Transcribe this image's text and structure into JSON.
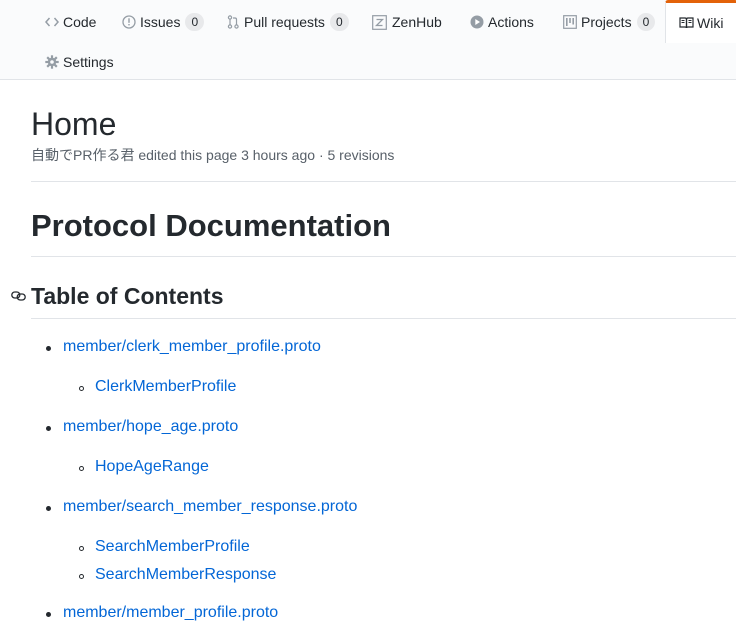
{
  "nav": {
    "tabs": [
      {
        "label": "Code",
        "icon": "code-icon"
      },
      {
        "label": "Issues",
        "icon": "issue-icon",
        "count": "0"
      },
      {
        "label": "Pull requests",
        "icon": "pull-request-icon",
        "count": "0"
      },
      {
        "label": "ZenHub",
        "icon": "zenhub-icon"
      },
      {
        "label": "Actions",
        "icon": "play-icon"
      },
      {
        "label": "Projects",
        "icon": "project-icon",
        "count": "0"
      },
      {
        "label": "Wiki",
        "icon": "book-icon",
        "selected": true
      },
      {
        "label": "Settings",
        "icon": "gear-icon"
      }
    ],
    "accent_color": "#e36209"
  },
  "wiki": {
    "title": "Home",
    "author": "自動でPR作る君",
    "edited_text": "edited this page",
    "time_ago": "3 hours ago",
    "separator": "·",
    "revisions": "5 revisions"
  },
  "content": {
    "heading1": "Protocol Documentation",
    "heading2": "Table of Contents",
    "toc": [
      {
        "file": "member/clerk_member_profile.proto",
        "children": [
          "ClerkMemberProfile"
        ]
      },
      {
        "file": "member/hope_age.proto",
        "children": [
          "HopeAgeRange"
        ]
      },
      {
        "file": "member/search_member_response.proto",
        "children": [
          "SearchMemberProfile",
          "SearchMemberResponse"
        ]
      },
      {
        "file": "member/member_profile.proto",
        "children": []
      }
    ],
    "link_color": "#0366d6"
  }
}
